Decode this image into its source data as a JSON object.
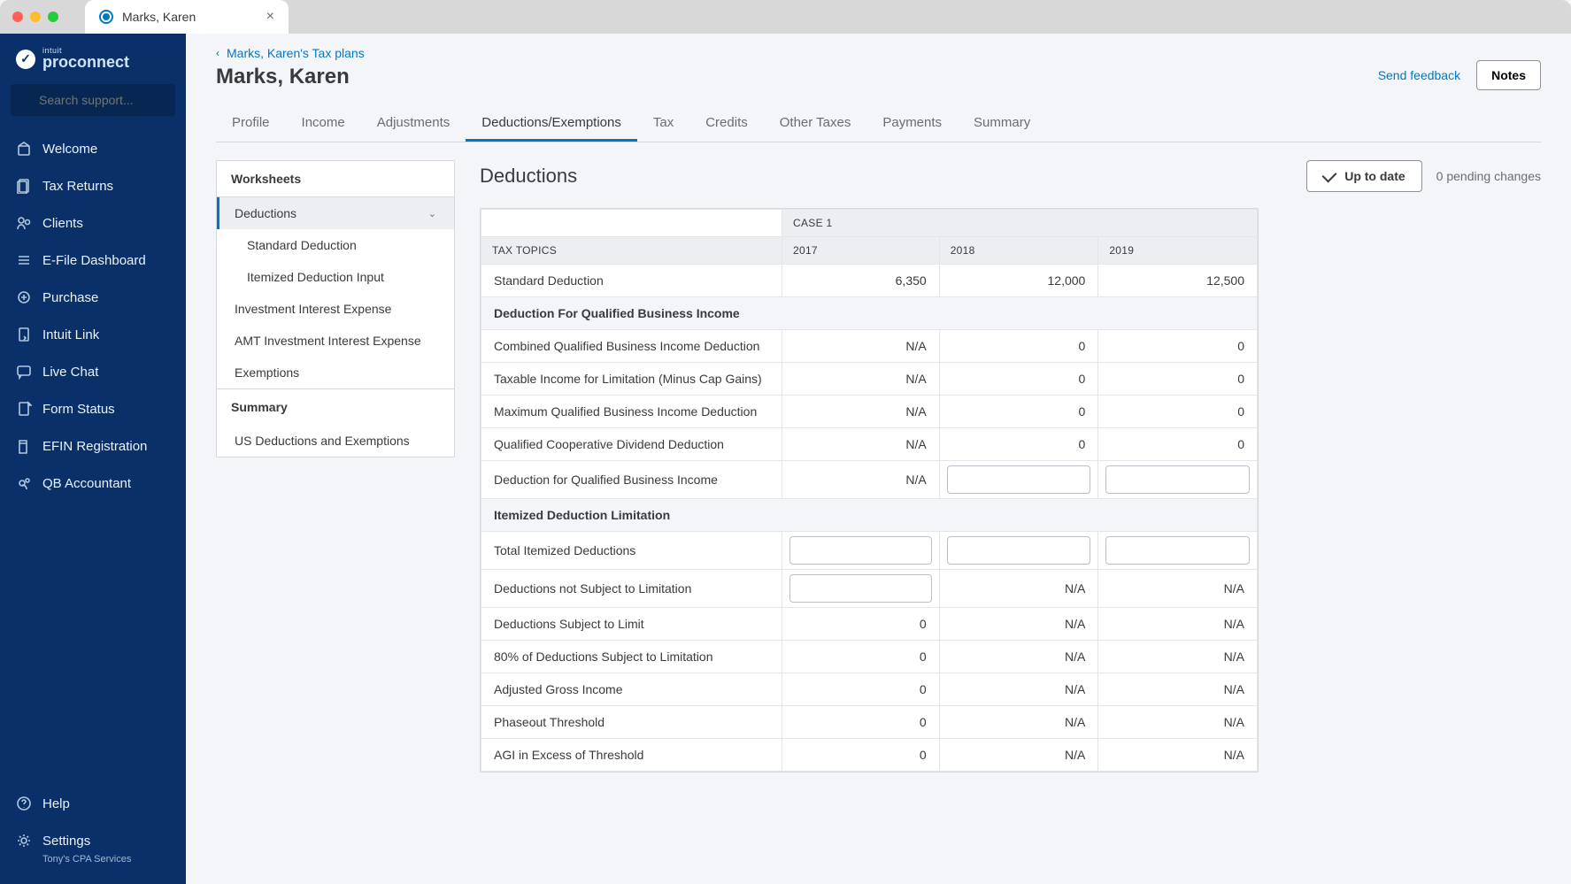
{
  "chrome": {
    "tab_title": "Marks, Karen"
  },
  "brand": {
    "small": "intuit",
    "big": "proconnect"
  },
  "search": {
    "placeholder": "Search support..."
  },
  "nav": {
    "items": [
      {
        "label": "Welcome",
        "icon": "welcome"
      },
      {
        "label": "Tax Returns",
        "icon": "returns"
      },
      {
        "label": "Clients",
        "icon": "clients"
      },
      {
        "label": "E-File Dashboard",
        "icon": "efile"
      },
      {
        "label": "Purchase",
        "icon": "purchase"
      },
      {
        "label": "Intuit Link",
        "icon": "link"
      },
      {
        "label": "Live Chat",
        "icon": "chat"
      },
      {
        "label": "Form Status",
        "icon": "form"
      },
      {
        "label": "EFIN Registration",
        "icon": "efin"
      },
      {
        "label": "QB Accountant",
        "icon": "qb"
      }
    ],
    "bottom": [
      {
        "label": "Help",
        "icon": "help"
      },
      {
        "label": "Settings",
        "icon": "settings",
        "sub": "Tony's CPA Services"
      }
    ]
  },
  "breadcrumb": {
    "back": "Marks, Karen's Tax plans"
  },
  "page": {
    "title": "Marks, Karen",
    "feedback": "Send feedback",
    "notes": "Notes"
  },
  "tabs": [
    "Profile",
    "Income",
    "Adjustments",
    "Deductions/Exemptions",
    "Tax",
    "Credits",
    "Other Taxes",
    "Payments",
    "Summary"
  ],
  "tabs_active": 3,
  "worksheets": {
    "header": "Worksheets",
    "rows": [
      {
        "label": "Deductions",
        "active": true,
        "expand": true
      },
      {
        "label": "Standard Deduction",
        "indent": true
      },
      {
        "label": "Itemized Deduction Input",
        "indent": true
      },
      {
        "label": "Investment Interest Expense"
      },
      {
        "label": "AMT Investment Interest Expense"
      },
      {
        "label": "Exemptions"
      }
    ],
    "summary_header": "Summary",
    "summary_rows": [
      {
        "label": "US Deductions and Exemptions"
      }
    ]
  },
  "section": {
    "heading": "Deductions",
    "up_to_date": "Up to date",
    "pending": "0 pending changes"
  },
  "table": {
    "case_label": "CASE 1",
    "topic_label": "TAX TOPICS",
    "years": [
      "2017",
      "2018",
      "2019"
    ],
    "rows": [
      {
        "topic": "Standard Deduction",
        "cells": [
          "6,350",
          "12,000",
          "12,500"
        ]
      },
      {
        "section": "Deduction For Qualified Business Income"
      },
      {
        "topic": "Combined Qualified Business Income Deduction",
        "cells": [
          "N/A",
          "0",
          "0"
        ]
      },
      {
        "topic": "Taxable Income for Limitation (Minus Cap Gains)",
        "cells": [
          "N/A",
          "0",
          "0"
        ]
      },
      {
        "topic": "Maximum Qualified Business Income Deduction",
        "cells": [
          "N/A",
          "0",
          "0"
        ]
      },
      {
        "topic": "Qualified Cooperative Dividend Deduction",
        "cells": [
          "N/A",
          "0",
          "0"
        ]
      },
      {
        "topic": "Deduction for Qualified Business Income",
        "cells": [
          "N/A",
          {
            "input": ""
          },
          {
            "input": ""
          }
        ]
      },
      {
        "section": "Itemized Deduction Limitation"
      },
      {
        "topic": "Total Itemized Deductions",
        "cells": [
          {
            "input": ""
          },
          {
            "input": ""
          },
          {
            "input": ""
          }
        ]
      },
      {
        "topic": "Deductions not Subject to Limitation",
        "cells": [
          {
            "input": ""
          },
          "N/A",
          "N/A"
        ]
      },
      {
        "topic": "Deductions Subject to Limit",
        "cells": [
          "0",
          "N/A",
          "N/A"
        ]
      },
      {
        "topic": "80% of Deductions Subject to Limitation",
        "cells": [
          "0",
          "N/A",
          "N/A"
        ]
      },
      {
        "topic": "Adjusted Gross Income",
        "cells": [
          "0",
          "N/A",
          "N/A"
        ]
      },
      {
        "topic": "Phaseout Threshold",
        "cells": [
          "0",
          "N/A",
          "N/A"
        ]
      },
      {
        "topic": "AGI in Excess of Threshold",
        "cells": [
          "0",
          "N/A",
          "N/A"
        ]
      }
    ]
  }
}
